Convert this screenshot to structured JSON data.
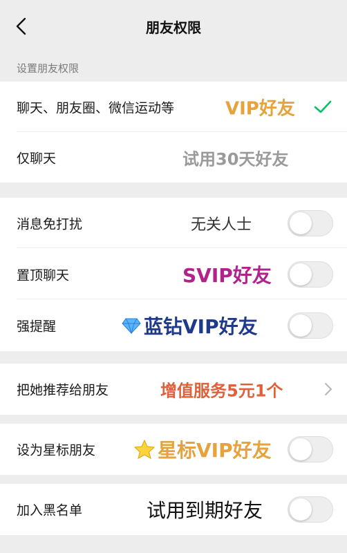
{
  "header": {
    "title": "朋友权限",
    "back_icon": "chevron-left-icon"
  },
  "section_label": "设置朋友权限",
  "permission_options": [
    {
      "label": "聊天、朋友圈、微信运动等",
      "annotation": "VIP好友",
      "annotation_color": "#e6a23c",
      "selected": true
    },
    {
      "label": "仅聊天",
      "annotation": "试用30天好友",
      "annotation_color": "#9a9a9a",
      "selected": false
    }
  ],
  "settings_group": [
    {
      "label": "消息免打扰",
      "annotation": "无关人士",
      "annotation_color": "#333333",
      "enabled": false
    },
    {
      "label": "置顶聊天",
      "annotation": "SVIP好友",
      "annotation_color": "#b0238c",
      "enabled": false
    },
    {
      "label": "强提醒",
      "annotation": "蓝钻VIP好友",
      "annotation_color": "#1f3a8a",
      "annotation_icon": "diamond-icon",
      "enabled": false
    }
  ],
  "recommend": {
    "label": "把她推荐给朋友",
    "annotation": "增值服务5元1个",
    "annotation_color": "#e0603a",
    "icon": "chevron-right-icon"
  },
  "star_friend": {
    "label": "设为星标朋友",
    "annotation": "星标VIP好友",
    "annotation_color": "#e6a23c",
    "annotation_icon": "star-icon",
    "enabled": false
  },
  "blacklist": {
    "label": "加入黑名单",
    "annotation": "试用到期好友",
    "annotation_color": "#111111",
    "enabled": false
  },
  "colors": {
    "check": "#07c160",
    "background": "#ededed"
  }
}
